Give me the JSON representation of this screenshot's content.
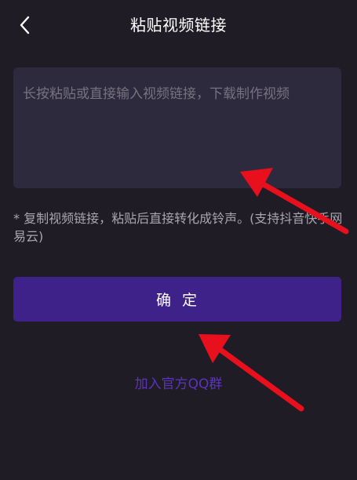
{
  "header": {
    "title": "粘贴视频链接",
    "back_icon": "chevron-left-icon"
  },
  "link_input": {
    "value": "",
    "placeholder": "长按粘贴或直接输入视频链接，下载制作视频"
  },
  "hint_text": "* 复制视频链接，粘贴后直接转化成铃声。(支持抖音快手网易云)",
  "confirm_label": "确  定",
  "join_group_label": "加入官方QQ群",
  "colors": {
    "background": "#1f1c26",
    "input_background": "#2e2a3d",
    "button_background": "#3f2289",
    "link_color": "#5b34b8",
    "annotation_arrow": "#e8101c"
  }
}
